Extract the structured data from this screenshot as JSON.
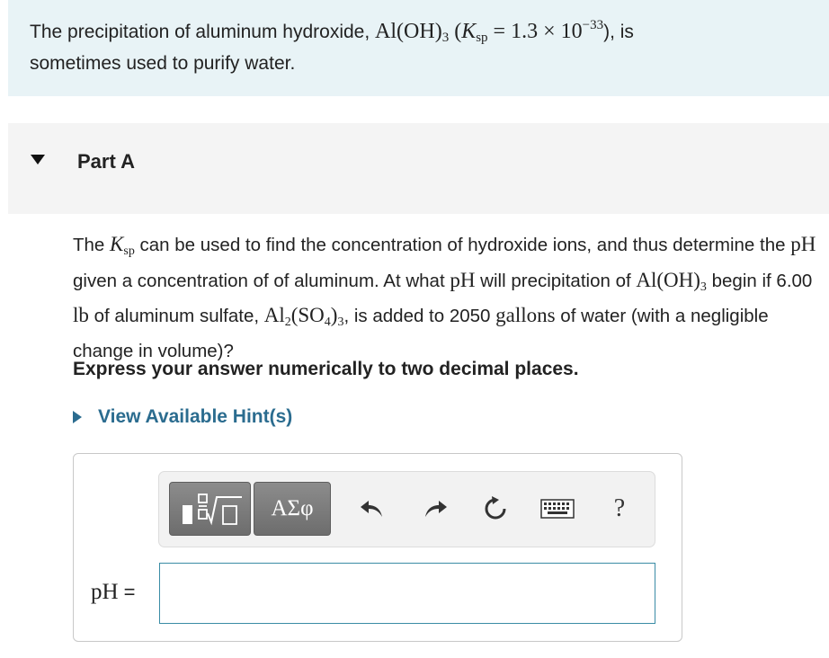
{
  "intro": {
    "text_before": "The precipitation of aluminum hydroxide, ",
    "formula_main": "Al(OH)",
    "formula_sub": "3",
    "ksp_open": " (",
    "ksp_K": "K",
    "ksp_sub": "sp",
    "ksp_eq": " = 1.3 × 10",
    "ksp_exp": "−33",
    "ksp_close": "), is",
    "line2": "sometimes used to purify water."
  },
  "part": {
    "title": "Part A"
  },
  "question": {
    "s1": "The ",
    "ksp_K": "K",
    "ksp_sub": "sp",
    "s2": " can be used to find the concentration of hydroxide ions, and thus determine the ",
    "ph1": "pH",
    "s3": " given a concentration of of aluminum. At what ",
    "ph2": "pH",
    "s4": " will precipitation of ",
    "alOH": "Al(OH)",
    "alOH_sub": "3",
    "s5": " begin if 6.00 ",
    "lb": "lb",
    "s6": " of aluminum sulfate, ",
    "al2_a": "Al",
    "al2_sub": "2",
    "al2_b": "(SO",
    "al2_sub2": "4",
    "al2_c": ")",
    "al2_sub3": "3",
    "s7": ", is added to 2050 ",
    "gallons": "gallons",
    "s8": " of water (with a negligible change in volume)?"
  },
  "instruction": "Express your answer numerically to two decimal places.",
  "hint": {
    "label": "View Available Hint(s)"
  },
  "toolbar": {
    "greek_label": "ΑΣφ",
    "help_label": "?"
  },
  "answer": {
    "label": "pH",
    "equals": " =",
    "value": "",
    "placeholder": ""
  },
  "icons": {
    "part_toggle": "caret-down-icon",
    "hint_toggle": "caret-right-icon",
    "templates": "templates-icon",
    "undo": "undo-icon",
    "redo": "redo-icon",
    "reset": "reset-icon",
    "keyboard": "keyboard-icon"
  }
}
